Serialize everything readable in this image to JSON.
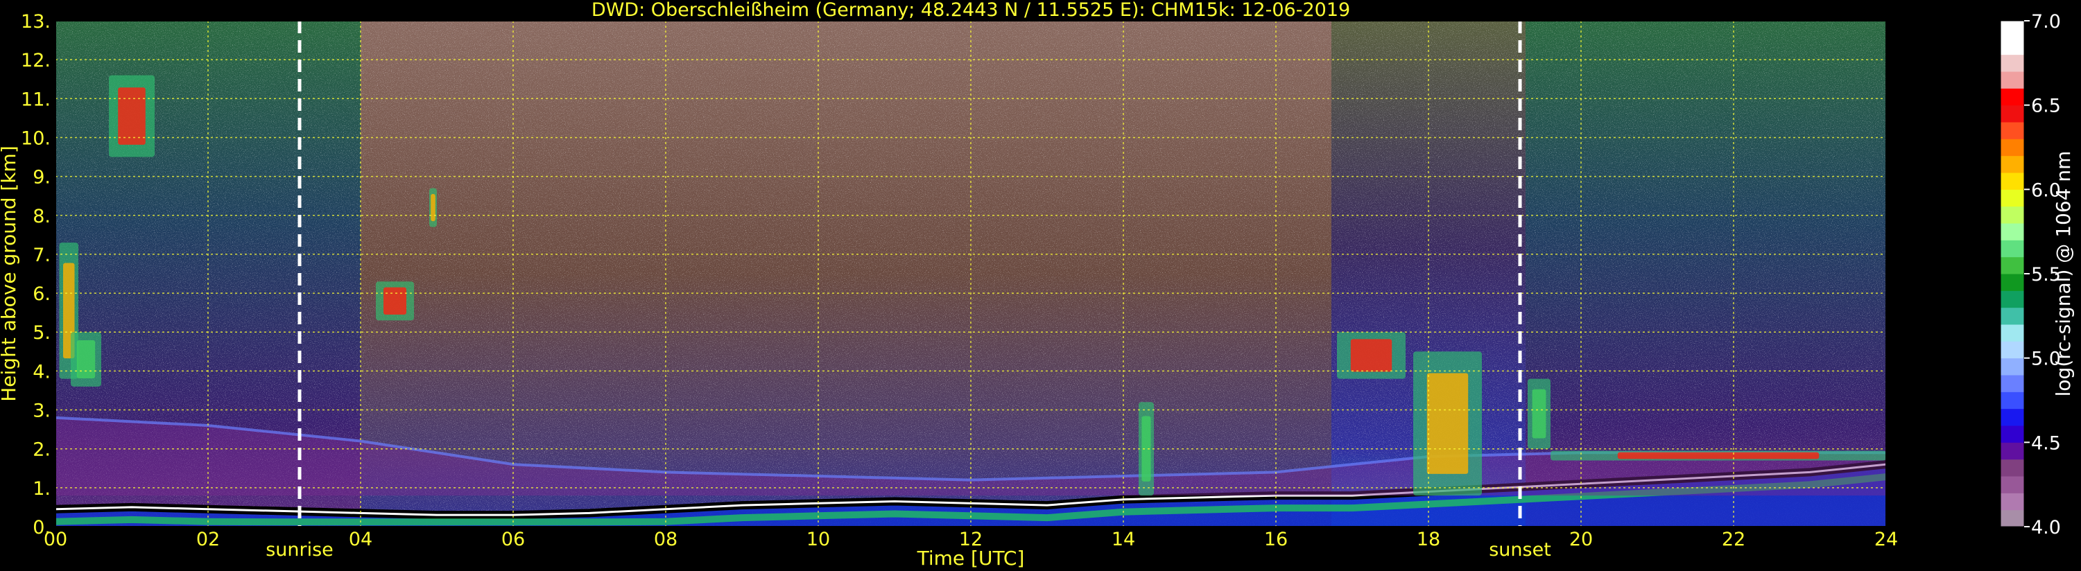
{
  "chart_data": {
    "type": "heatmap",
    "title": "DWD: Oberschleißheim (Germany; 48.2443 N / 11.5525 E):    CHM15k: 12-06-2019",
    "xlabel": "Time [UTC]",
    "ylabel": "Height above ground [km]",
    "xlim": [
      0,
      24
    ],
    "ylim": [
      0,
      13
    ],
    "x_tick_labels": [
      "00",
      "02",
      "04",
      "06",
      "08",
      "10",
      "12",
      "14",
      "16",
      "18",
      "20",
      "22",
      "24"
    ],
    "y_tick_labels": [
      "0.",
      "1.",
      "2.",
      "3.",
      "4.",
      "5.",
      "6.",
      "7.",
      "8.",
      "9.",
      "10.",
      "11.",
      "12.",
      "13."
    ],
    "grid": true,
    "markers": [
      {
        "label": "sunrise",
        "time": 3.2
      },
      {
        "label": "sunset",
        "time": 19.2
      }
    ],
    "colorbar": {
      "label": "log(rc-signal) @ 1064 nm",
      "range": [
        4.0,
        7.0
      ],
      "tick_labels": [
        "4.0",
        "4.5",
        "5.0",
        "5.5",
        "6.0",
        "6.5",
        "7.0"
      ],
      "colors": [
        "#a88ea8",
        "#b07ab0",
        "#985898",
        "#804080",
        "#6010a0",
        "#3000d0",
        "#1818f0",
        "#3a50ff",
        "#6a80ff",
        "#90b0ff",
        "#b0d8ff",
        "#a0e8f0",
        "#40c0a8",
        "#10a060",
        "#109820",
        "#40c040",
        "#60e080",
        "#a0ffa0",
        "#c0ff60",
        "#e8ff20",
        "#ffe000",
        "#ffb000",
        "#ff8000",
        "#ff5020",
        "#f01010",
        "#ff0000",
        "#f0a0a0",
        "#f0c8c8",
        "#ffffff",
        "#ffffff"
      ]
    },
    "layers": [
      {
        "name": "boundary layer top",
        "time": [
          0,
          1,
          2,
          3,
          4,
          5,
          6,
          7,
          8,
          9,
          10,
          11,
          12,
          13,
          14,
          15,
          16,
          17,
          18,
          19,
          20,
          21,
          22,
          23,
          24
        ],
        "height_km": [
          0.45,
          0.5,
          0.45,
          0.4,
          0.35,
          0.3,
          0.3,
          0.35,
          0.45,
          0.55,
          0.6,
          0.65,
          0.6,
          0.55,
          0.7,
          0.75,
          0.8,
          0.8,
          0.9,
          1.0,
          1.1,
          1.2,
          1.3,
          1.4,
          1.6
        ]
      },
      {
        "name": "residual layer",
        "time": [
          0,
          2,
          4,
          6,
          8,
          10,
          12,
          14,
          16,
          18,
          20,
          22,
          24
        ],
        "height_km": [
          2.8,
          2.6,
          2.2,
          1.6,
          1.4,
          1.3,
          1.2,
          1.3,
          1.4,
          1.8,
          1.9,
          1.9,
          1.9
        ]
      }
    ],
    "cloud_features": [
      {
        "t_start": 0.7,
        "t_end": 1.3,
        "base_km": 9.5,
        "top_km": 11.6
      },
      {
        "t_start": 0.05,
        "t_end": 0.3,
        "base_km": 3.8,
        "top_km": 7.3
      },
      {
        "t_start": 0.2,
        "t_end": 0.6,
        "base_km": 3.6,
        "top_km": 5.0
      },
      {
        "t_start": 4.2,
        "t_end": 4.7,
        "base_km": 5.3,
        "top_km": 6.3
      },
      {
        "t_start": 4.9,
        "t_end": 5.0,
        "base_km": 7.7,
        "top_km": 8.7
      },
      {
        "t_start": 14.2,
        "t_end": 14.4,
        "base_km": 0.8,
        "top_km": 3.2
      },
      {
        "t_start": 16.8,
        "t_end": 17.7,
        "base_km": 3.8,
        "top_km": 5.0
      },
      {
        "t_start": 17.8,
        "t_end": 18.7,
        "base_km": 0.8,
        "top_km": 4.5
      },
      {
        "t_start": 19.3,
        "t_end": 19.6,
        "base_km": 2.0,
        "top_km": 3.8
      },
      {
        "t_start": 19.6,
        "t_end": 24,
        "base_km": 1.7,
        "top_km": 1.95
      }
    ]
  }
}
